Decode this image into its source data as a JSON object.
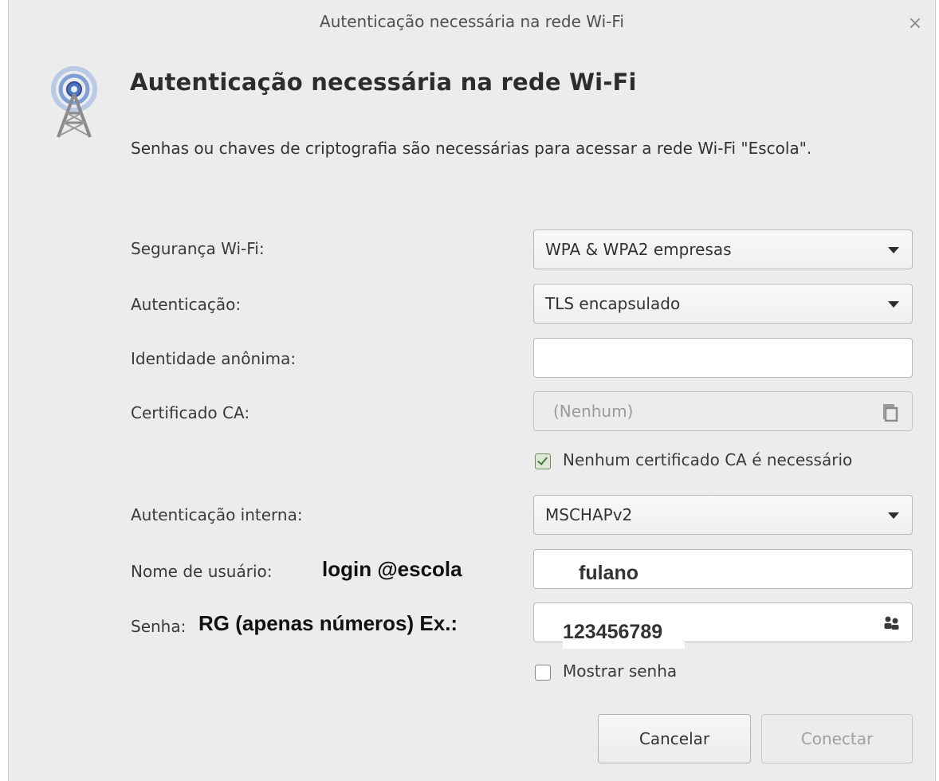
{
  "window": {
    "title": "Autenticação necessária na rede Wi-Fi",
    "close_glyph": "×"
  },
  "header": {
    "heading": "Autenticação necessária na rede Wi-Fi",
    "description": "Senhas ou chaves de criptografia são necessárias para acessar a rede Wi-Fi \"Escola\".",
    "icon": "wifi-antenna-icon"
  },
  "form": {
    "wifi_security": {
      "label": "Segurança Wi-Fi:",
      "value": "WPA & WPA2 empresas"
    },
    "authentication": {
      "label": "Autenticação:",
      "value": "TLS encapsulado"
    },
    "anonymous_identity": {
      "label": "Identidade anônima:",
      "value": ""
    },
    "ca_certificate": {
      "label": "Certificado CA:",
      "value": "(Nenhum)",
      "icon": "document-icon"
    },
    "no_ca_required": {
      "label": "Nenhum certificado CA é necessário",
      "checked": true
    },
    "inner_auth": {
      "label": "Autenticação interna:",
      "value": "MSCHAPv2"
    },
    "username": {
      "label": "Nome de usuário:",
      "value": "fulano"
    },
    "password": {
      "label": "Senha:",
      "value": "123456789",
      "icon": "users-icon"
    },
    "show_password": {
      "label": "Mostrar senha",
      "checked": false
    }
  },
  "annotations": {
    "username_hint": "login @escola",
    "password_hint": "RG (apenas números) Ex.:"
  },
  "buttons": {
    "cancel": "Cancelar",
    "connect": "Conectar"
  }
}
